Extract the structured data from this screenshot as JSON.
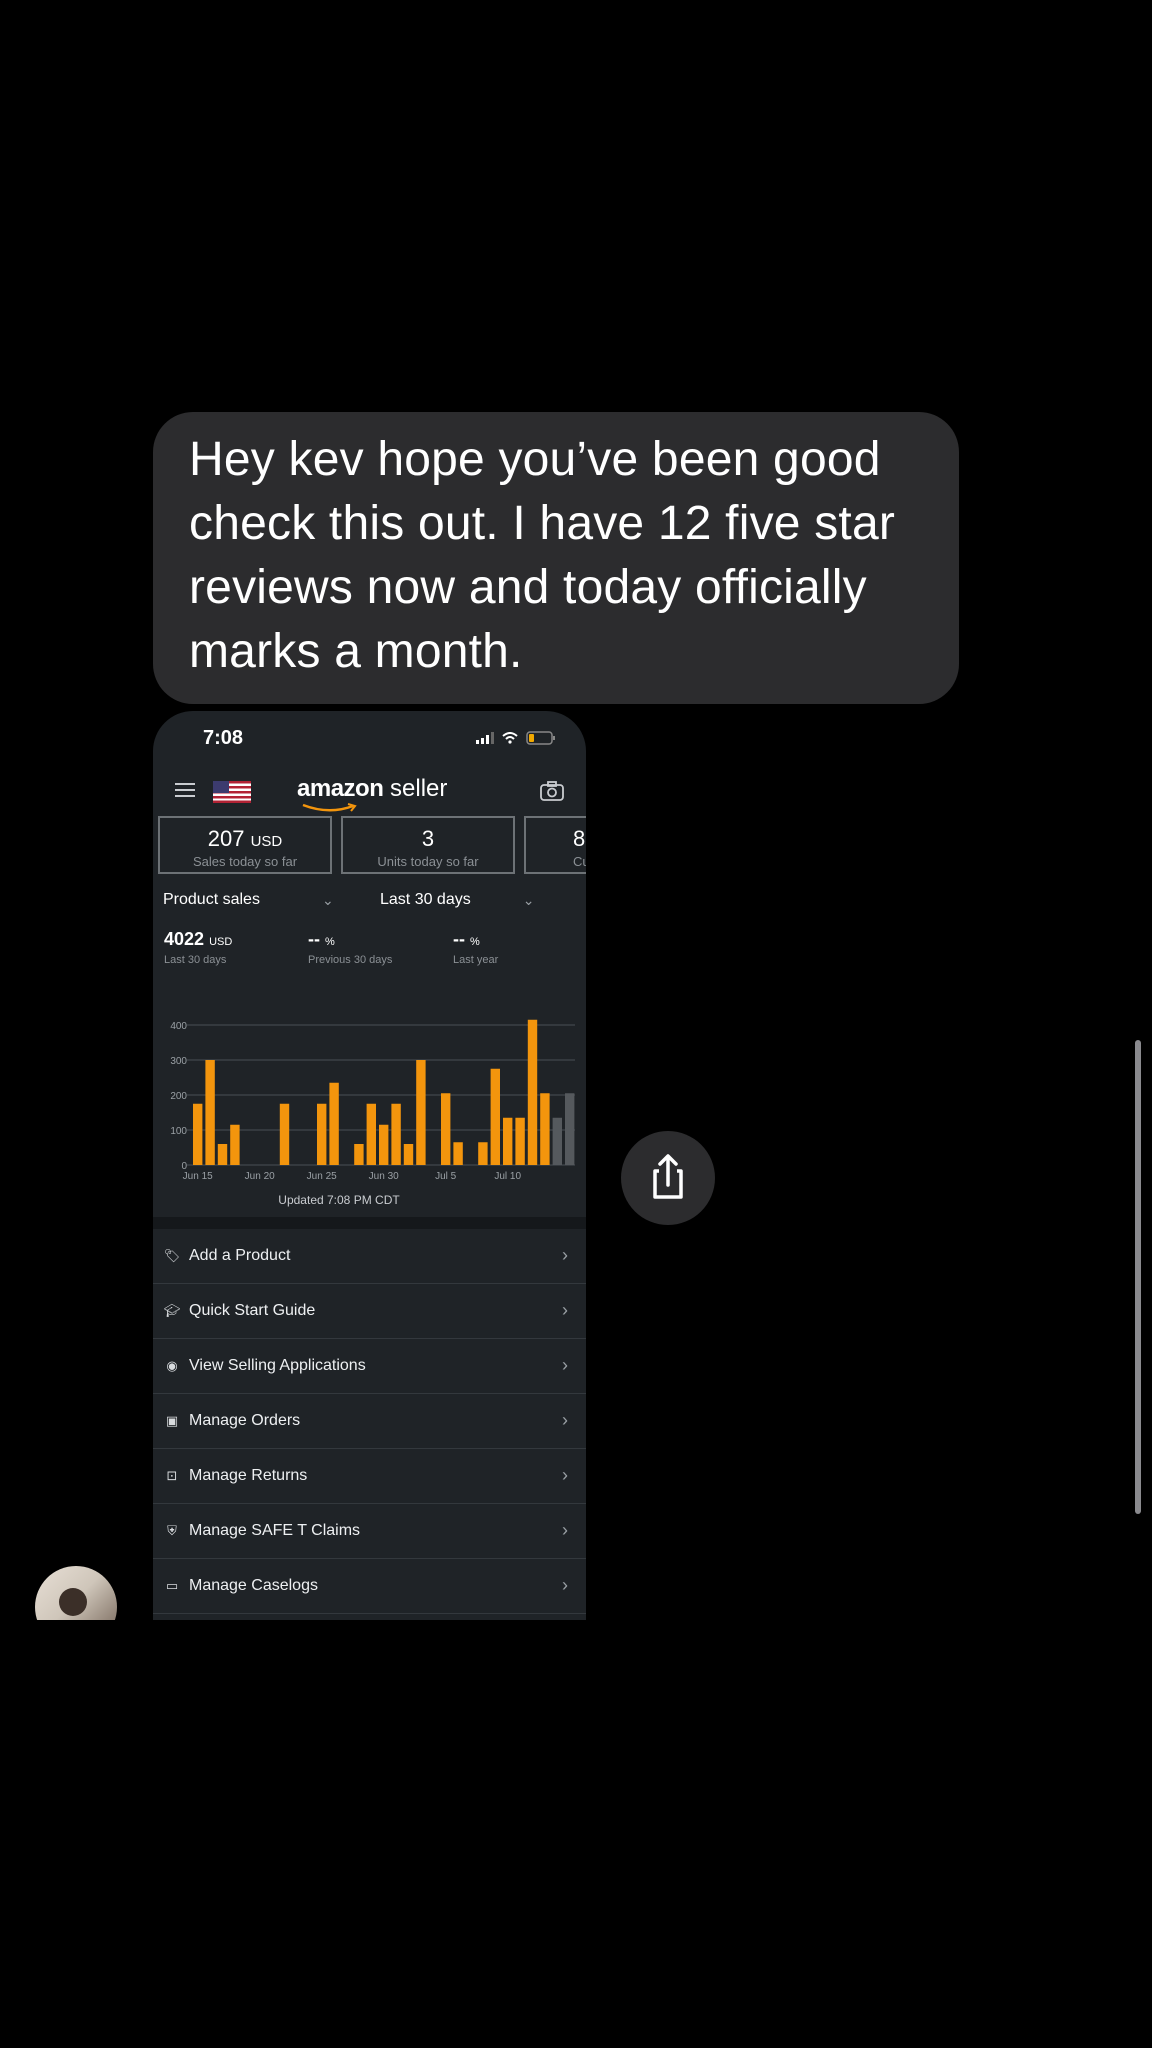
{
  "message": {
    "text": "Hey kev hope you’ve been good check this out. I have 12 five star reviews now and today officially marks a month."
  },
  "screenshot": {
    "status_time": "7:08",
    "app": {
      "logo_main": "amazon",
      "logo_suffix": " seller"
    },
    "tiles": [
      {
        "value": "207",
        "unit": "USD",
        "label": "Sales today so far"
      },
      {
        "value": "3",
        "unit": "",
        "label": "Units today so far"
      },
      {
        "value": "8",
        "unit": "",
        "label": "Curr"
      }
    ],
    "filters": {
      "metric": "Product sales",
      "range": "Last 30 days"
    },
    "metrics": [
      {
        "value": "4022",
        "unit": "USD",
        "label": "Last 30 days"
      },
      {
        "value": "--",
        "unit": "%",
        "label": "Previous 30 days"
      },
      {
        "value": "--",
        "unit": "%",
        "label": "Last year"
      }
    ],
    "chart_data": {
      "type": "bar",
      "title": "",
      "xlabel": "",
      "ylabel": "",
      "ylim": [
        0,
        400
      ],
      "yticks": [
        "0",
        "100",
        "200",
        "300",
        "400"
      ],
      "xticks": [
        "Jun 15",
        "Jun 20",
        "Jun 25",
        "Jun 30",
        "Jul 5",
        "Jul 10"
      ],
      "categories": [
        "Jun 15",
        "Jun 16",
        "Jun 17",
        "Jun 18",
        "Jun 19",
        "Jun 20",
        "Jun 21",
        "Jun 22",
        "Jun 23",
        "Jun 24",
        "Jun 25",
        "Jun 26",
        "Jun 27",
        "Jun 28",
        "Jun 29",
        "Jun 30",
        "Jul 1",
        "Jul 2",
        "Jul 3",
        "Jul 4",
        "Jul 5",
        "Jul 6",
        "Jul 7",
        "Jul 8",
        "Jul 9",
        "Jul 10",
        "Jul 11",
        "Jul 12",
        "Jul 13",
        "Jul 14"
      ],
      "values": [
        175,
        300,
        60,
        115,
        0,
        0,
        0,
        175,
        0,
        0,
        175,
        235,
        0,
        60,
        175,
        115,
        175,
        60,
        300,
        0,
        205,
        65,
        0,
        65,
        275,
        135,
        135,
        415,
        205,
        135
      ],
      "partial_value": 205,
      "colors": {
        "bar": "#f3950d",
        "today": "#55595d",
        "partial": "#55595d"
      },
      "grid": true
    },
    "updated": "Updated 7:08 PM CDT",
    "menu": [
      {
        "label": "Add a Product",
        "icon": "tag-icon"
      },
      {
        "label": "Quick Start Guide",
        "icon": "graduation-cap-icon"
      },
      {
        "label": "View Selling Applications",
        "icon": "eye-icon"
      },
      {
        "label": "Manage Orders",
        "icon": "box-icon"
      },
      {
        "label": "Manage Returns",
        "icon": "return-box-icon"
      },
      {
        "label": "Manage SAFE T Claims",
        "icon": "shield-icon"
      },
      {
        "label": "Manage Caselogs",
        "icon": "chat-icon"
      }
    ]
  }
}
